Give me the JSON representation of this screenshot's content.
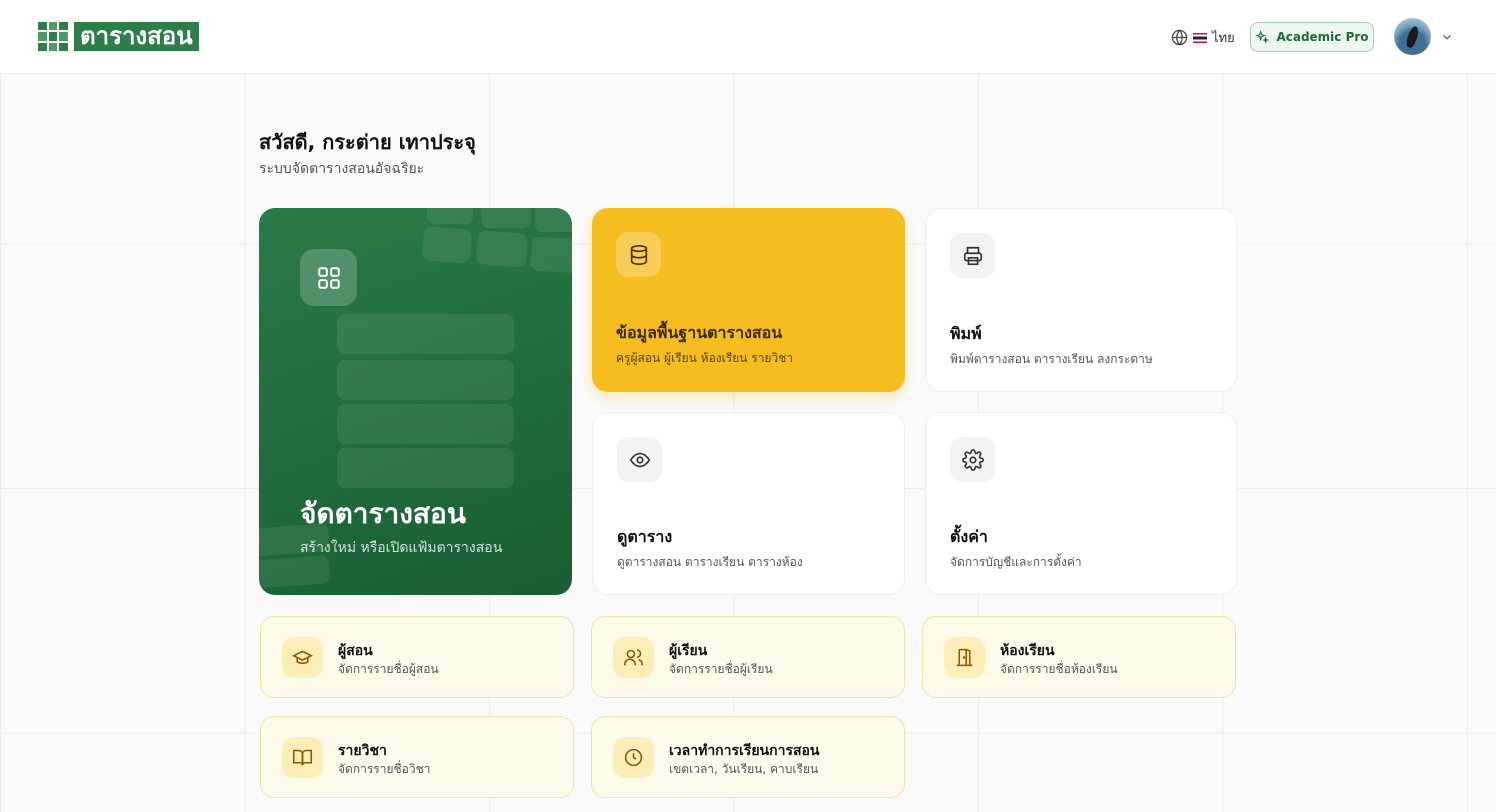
{
  "header": {
    "logo_text": "ตารางสอน",
    "lang_label": "ไทย",
    "plan_badge": "Academic Pro"
  },
  "greeting": {
    "title": "สวัสดี, กระต่าย เทาประจุ",
    "subtitle": "ระบบจัดตารางสอนอัจฉริยะ"
  },
  "hero": {
    "title": "จัดตารางสอน",
    "subtitle": "สร้างใหม่ หรือเปิดแฟ้มตารางสอน"
  },
  "cards": {
    "master": {
      "title": "ข้อมูลพื้นฐานตารางสอน",
      "subtitle": "ครูผู้สอน ผู้เรียน ห้องเรียน รายวิชา"
    },
    "print": {
      "title": "พิมพ์",
      "subtitle": "พิมพ์ตารางสอน ตารางเรียน ลงกระดาษ"
    },
    "view": {
      "title": "ดูตาราง",
      "subtitle": "ดูตารางสอน ตารางเรียน ตารางห้อง"
    },
    "settings": {
      "title": "ตั้งค่า",
      "subtitle": "จัดการบัญชีและการตั้งค่า"
    }
  },
  "quick": {
    "teachers": {
      "title": "ผู้สอน",
      "subtitle": "จัดการรายชื่อผู้สอน"
    },
    "students": {
      "title": "ผู้เรียน",
      "subtitle": "จัดการรายชื่อผู้เรียน"
    },
    "rooms": {
      "title": "ห้องเรียน",
      "subtitle": "จัดการรายชื่อห้องเรียน"
    },
    "subjects": {
      "title": "รายวิชา",
      "subtitle": "จัดการรายชื่อวิชา"
    },
    "periods": {
      "title": "เวลาทำการเรียนการสอน",
      "subtitle": "เขตเวลา, วันเรียน, คาบเรียน"
    }
  },
  "colors": {
    "brand_green": "#2e7d4a",
    "accent_yellow": "#f5bd20",
    "quick_bg": "#fffbea"
  },
  "icons": {
    "language": "globe-icon",
    "plan": "sparkles-icon",
    "hero": "grid-icon",
    "master": "database-icon",
    "print": "printer-icon",
    "view": "eye-icon",
    "settings": "gear-icon",
    "teachers": "graduation-cap-icon",
    "students": "users-icon",
    "rooms": "door-icon",
    "subjects": "book-icon",
    "periods": "clock-icon"
  }
}
